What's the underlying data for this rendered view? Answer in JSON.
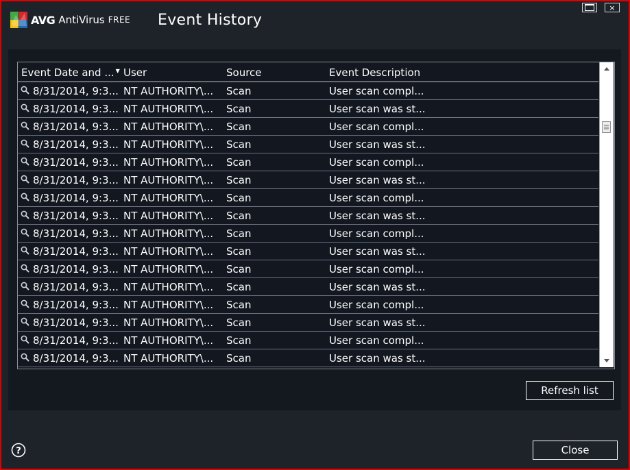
{
  "app": {
    "brand": "AVG",
    "product": "AntiVirus",
    "edition": "FREE",
    "dialog_title": "Event History"
  },
  "window_controls": {
    "maximize_icon": "maximize-icon",
    "close_glyph": "×"
  },
  "table": {
    "columns": [
      "Event Date and ...",
      "User",
      "Source",
      "Event Description"
    ],
    "sorted_column": 0,
    "rows": [
      {
        "date": "8/31/2014, 9:3...",
        "user": "NT AUTHORITY\\...",
        "source": "Scan",
        "description": "User scan compl..."
      },
      {
        "date": "8/31/2014, 9:3...",
        "user": "NT AUTHORITY\\...",
        "source": "Scan",
        "description": "User scan was st..."
      },
      {
        "date": "8/31/2014, 9:3...",
        "user": "NT AUTHORITY\\...",
        "source": "Scan",
        "description": "User scan compl..."
      },
      {
        "date": "8/31/2014, 9:3...",
        "user": "NT AUTHORITY\\...",
        "source": "Scan",
        "description": "User scan was st..."
      },
      {
        "date": "8/31/2014, 9:3...",
        "user": "NT AUTHORITY\\...",
        "source": "Scan",
        "description": "User scan compl..."
      },
      {
        "date": "8/31/2014, 9:3...",
        "user": "NT AUTHORITY\\...",
        "source": "Scan",
        "description": "User scan was st..."
      },
      {
        "date": "8/31/2014, 9:3...",
        "user": "NT AUTHORITY\\...",
        "source": "Scan",
        "description": "User scan compl..."
      },
      {
        "date": "8/31/2014, 9:3...",
        "user": "NT AUTHORITY\\...",
        "source": "Scan",
        "description": "User scan was st..."
      },
      {
        "date": "8/31/2014, 9:3...",
        "user": "NT AUTHORITY\\...",
        "source": "Scan",
        "description": "User scan compl..."
      },
      {
        "date": "8/31/2014, 9:3...",
        "user": "NT AUTHORITY\\...",
        "source": "Scan",
        "description": "User scan was st..."
      },
      {
        "date": "8/31/2014, 9:3...",
        "user": "NT AUTHORITY\\...",
        "source": "Scan",
        "description": "User scan compl..."
      },
      {
        "date": "8/31/2014, 9:3...",
        "user": "NT AUTHORITY\\...",
        "source": "Scan",
        "description": "User scan was st..."
      },
      {
        "date": "8/31/2014, 9:3...",
        "user": "NT AUTHORITY\\...",
        "source": "Scan",
        "description": "User scan compl..."
      },
      {
        "date": "8/31/2014, 9:3...",
        "user": "NT AUTHORITY\\...",
        "source": "Scan",
        "description": "User scan was st..."
      },
      {
        "date": "8/31/2014, 9:3...",
        "user": "NT AUTHORITY\\...",
        "source": "Scan",
        "description": "User scan compl..."
      },
      {
        "date": "8/31/2014, 9:3...",
        "user": "NT AUTHORITY\\...",
        "source": "Scan",
        "description": "User scan was st..."
      }
    ],
    "row_icon": "magnifier-icon"
  },
  "buttons": {
    "refresh_label": "Refresh list",
    "close_label": "Close"
  },
  "help": {
    "glyph": "?"
  },
  "colors": {
    "window_border": "#e00000",
    "background": "#1e232a",
    "panel": "#141920",
    "logo_green": "#45a845",
    "logo_red": "#d8262b",
    "logo_yellow": "#f3c316",
    "logo_blue": "#1f6bb6"
  }
}
